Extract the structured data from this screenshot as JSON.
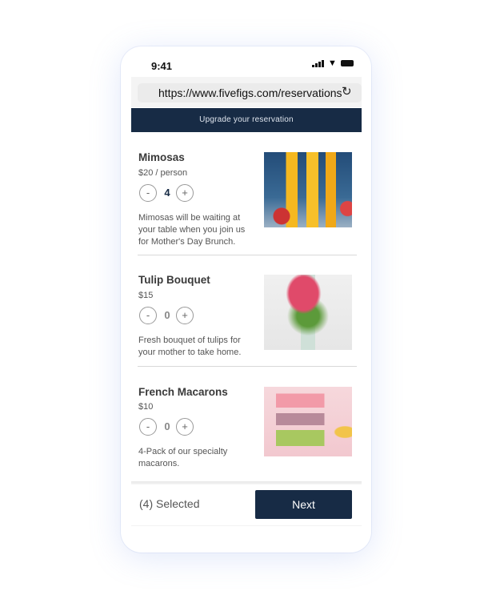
{
  "status_bar": {
    "time": "9:41",
    "icons": [
      "signal-icon",
      "wifi-icon",
      "battery-icon"
    ]
  },
  "browser": {
    "url": "https://www.fivefigs.com/reservations",
    "reload_icon": "reload-icon"
  },
  "banner": {
    "text": "Upgrade your reservation"
  },
  "items": [
    {
      "title": "Mimosas",
      "price": "$20 / person",
      "quantity": "4",
      "minus": "-",
      "plus": "+",
      "description": "Mimosas will be waiting at your table when you join us for Mother's Day Brunch.",
      "image": "mimosas-photo"
    },
    {
      "title": "Tulip Bouquet",
      "price": "$15",
      "quantity": "0",
      "minus": "-",
      "plus": "+",
      "description": "Fresh bouquet of tulips for your mother to take home.",
      "image": "tulips-photo"
    },
    {
      "title": "French Macarons",
      "price": "$10",
      "quantity": "0",
      "minus": "-",
      "plus": "+",
      "description": "4-Pack of our specialty macarons.",
      "image": "macarons-photo"
    }
  ],
  "footer": {
    "selected": "(4) Selected",
    "next_label": "Next"
  },
  "colors": {
    "navy": "#172b45"
  }
}
